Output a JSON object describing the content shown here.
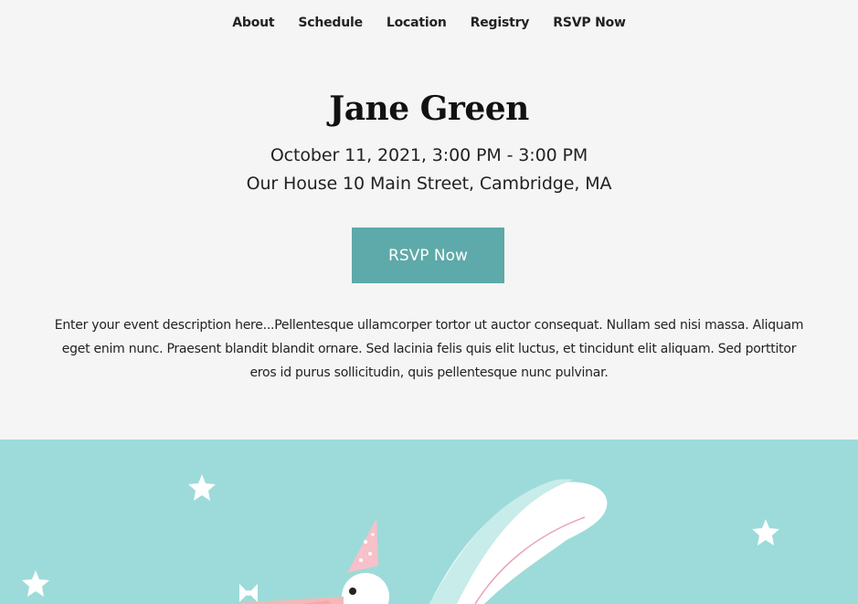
{
  "nav": {
    "items": [
      "About",
      "Schedule",
      "Location",
      "Registry",
      "RSVP Now"
    ]
  },
  "event": {
    "title": "Jane Green",
    "date": "October 11, 2021, 3:00 PM - 3:00 PM",
    "address": "Our House 10 Main Street, Cambridge, MA",
    "rsvp_label": "RSVP Now",
    "description": "Enter your event description here...Pellentesque ullamcorper tortor ut auctor consequat. Nullam sed nisi massa. Aliquam eget enim nunc. Praesent blandit blandit ornare. Sed lacinia felis quis elit luctus, et tincidunt elit aliquam. Sed porttitor eros id purus sollicitudin, quis pellentesque nunc pulvinar."
  },
  "colors": {
    "accent": "#5ea9a9",
    "banner_bg": "#9cdbd9",
    "page_bg": "#f5f5f5"
  },
  "icons": {
    "banner_illustration": "stork-with-party-hat-icon",
    "stars": "star-icon"
  }
}
